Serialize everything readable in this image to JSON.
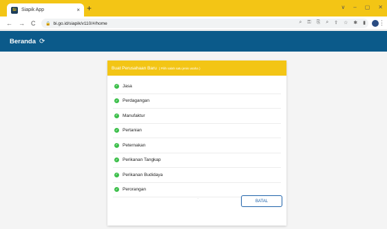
{
  "browser": {
    "tab_title": "Siapik App",
    "favicon_letter": "Si",
    "tab_close": "×",
    "new_tab": "+",
    "window_controls": [
      "∨",
      "–",
      "▢",
      "✕"
    ],
    "nav": {
      "back": "←",
      "forward": "→",
      "reload": "C"
    },
    "url": "bi.go.id/siapik/v110/#/home"
  },
  "app": {
    "title": "Beranda",
    "refresh_icon": "refresh-icon"
  },
  "card": {
    "title": "Buat Perusahaan Baru",
    "hint": "( Pilih salah satu jenis usaha )",
    "items": [
      "Jasa",
      "Perdagangan",
      "Manufaktur",
      "Pertanian",
      "Peternakan",
      "Perikanan Tangkap",
      "Perikanan Budidaya",
      "Perorangan"
    ],
    "cancel_label": "BATAL",
    "dot": "·"
  },
  "colors": {
    "brand_yellow": "#f3c515",
    "header_blue": "#0b5a8a",
    "check_green": "#3cbf4a",
    "button_blue": "#1a5fa8"
  }
}
